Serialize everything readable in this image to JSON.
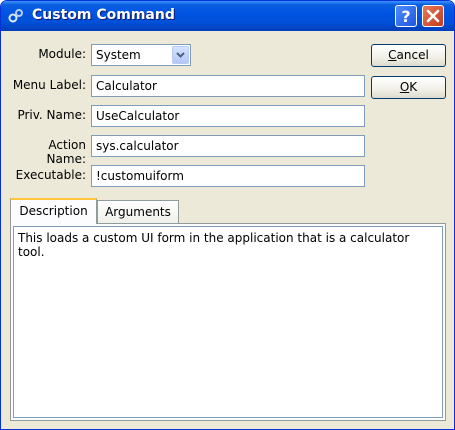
{
  "window": {
    "title": "Custom Command"
  },
  "form": {
    "module_label": "Module:",
    "module_value": "System",
    "menu_label_label": "Menu Label:",
    "menu_label_value": "Calculator",
    "priv_name_label": "Priv. Name:",
    "priv_name_value": "UseCalculator",
    "action_name_label": "Action Name:",
    "action_name_value": "sys.calculator",
    "executable_label": "Executable:",
    "executable_value": "!customuiform"
  },
  "buttons": {
    "cancel_first": "C",
    "cancel_rest": "ancel",
    "ok_first": "O",
    "ok_rest": "K"
  },
  "tabs": [
    {
      "label": "Description",
      "active": true
    },
    {
      "label": "Arguments",
      "active": false
    }
  ],
  "description_text": "This loads a custom UI form in the application that is a calculator tool.",
  "icons": [
    "gears-icon",
    "help-icon",
    "close-icon",
    "chevron-down-icon"
  ],
  "colors": {
    "titlebar": "#0054e3",
    "window_bg": "#ece9d8",
    "tab_accent": "#ffc83c",
    "close_button": "#d24a2a"
  }
}
